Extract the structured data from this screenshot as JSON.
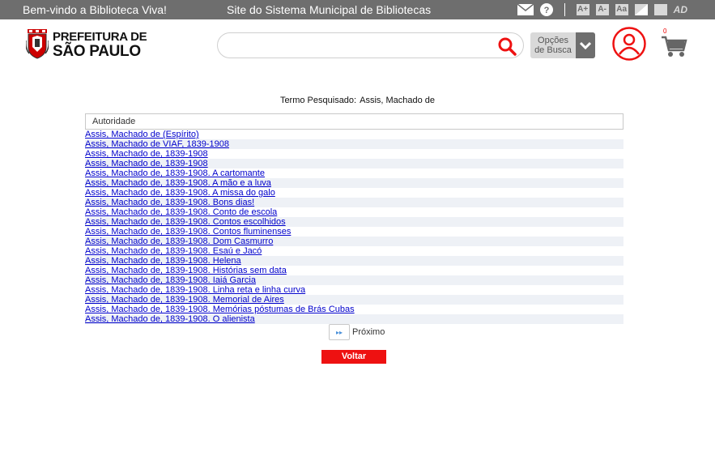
{
  "topbar": {
    "welcome": "Bem-vindo a Biblioteca Viva!",
    "site": "Site do Sistema Municipal de Bibliotecas",
    "font_increase": "A+",
    "font_decrease": "A-",
    "font_reset": "Aa",
    "accessibility": "AD",
    "icons": [
      "mail-icon",
      "help-icon",
      "contrast-icon",
      "contrast-toggle-icon",
      "audio-description-icon"
    ]
  },
  "header": {
    "logo_line1": "PREFEITURA DE",
    "logo_line2": "SÃO PAULO",
    "search_value": "",
    "options_line1": "Opções",
    "options_line2": "de Busca",
    "cart_count": "0"
  },
  "search": {
    "term_label": "Termo Pesquisado:",
    "term_value": "Assis, Machado de"
  },
  "results": {
    "header": "Autoridade",
    "items": [
      "Assis, Machado de (Espírito)",
      "Assis, Machado de VIAF, 1839-1908",
      "Assis, Machado de, 1839-1908",
      "Assis, Machado de, 1839-1908",
      "Assis, Machado de, 1839-1908. A cartomante",
      "Assis, Machado de, 1839-1908. A mão e a luva",
      "Assis, Machado de, 1839-1908. A missa do galo",
      "Assis, Machado de, 1839-1908. Bons dias!",
      "Assis, Machado de, 1839-1908. Conto de escola",
      "Assis, Machado de, 1839-1908. Contos escolhidos",
      "Assis, Machado de, 1839-1908. Contos fluminenses",
      "Assis, Machado de, 1839-1908. Dom Casmurro",
      "Assis, Machado de, 1839-1908. Esaú e Jacó",
      "Assis, Machado de, 1839-1908. Helena",
      "Assis, Machado de, 1839-1908. Histórias sem data",
      "Assis, Machado de, 1839-1908. Iaiá Garcia",
      "Assis, Machado de, 1839-1908. Linha reta e linha curva",
      "Assis, Machado de, 1839-1908. Memorial de Aires",
      "Assis, Machado de, 1839-1908. Memórias póstumas de Brás Cubas",
      "Assis, Machado de, 1839-1908. O alienista"
    ]
  },
  "pager": {
    "next_glyph": "▸▸",
    "next_label": "Próximo"
  },
  "actions": {
    "back_label": "Voltar"
  },
  "colors": {
    "topbar": "#6e6e6e",
    "accent_red": "#ee1111",
    "link": "#0000cc",
    "row_alt": "#eef1f6"
  }
}
